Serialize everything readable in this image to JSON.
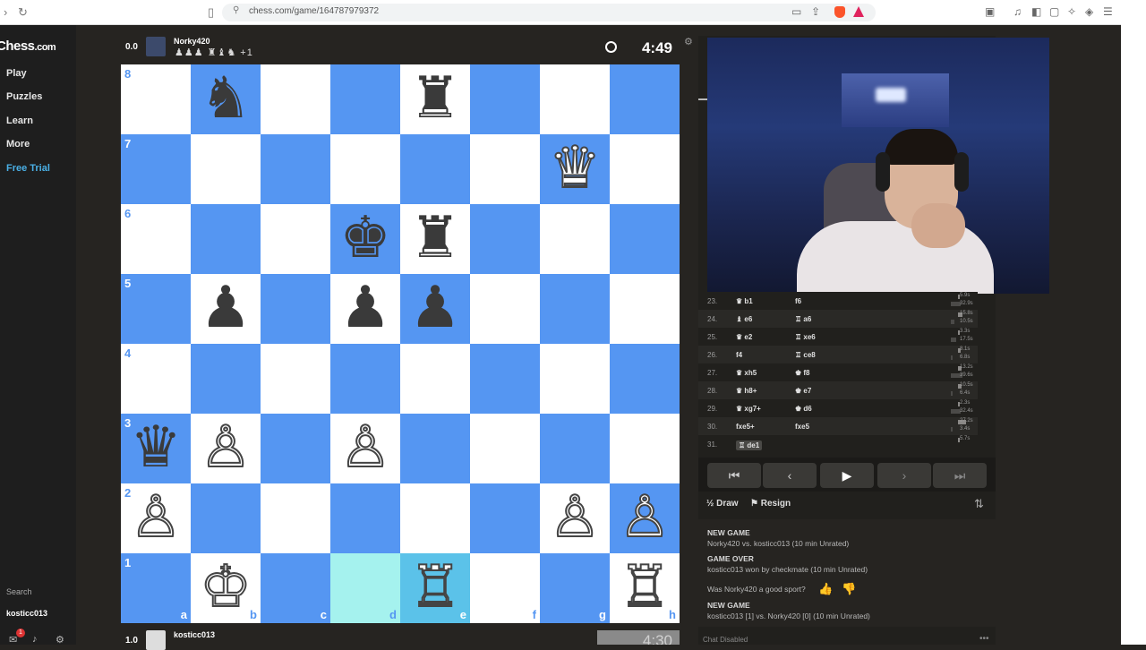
{
  "browser": {
    "url": "chess.com/game/164787979372"
  },
  "sidebar": {
    "logo": "Chess",
    "logo_suffix": ".com",
    "items": [
      {
        "label": "Play"
      },
      {
        "label": "Puzzles"
      },
      {
        "label": "Learn"
      },
      {
        "label": "More"
      },
      {
        "label": "Free Trial"
      }
    ],
    "search_label": "Search",
    "username": "kosticc013",
    "notification_count": "1"
  },
  "top_player": {
    "score": "0.0",
    "name": "Norky420",
    "captured": "♟♟♟ ♜♝♞ +1",
    "clock": "4:49"
  },
  "bottom_player": {
    "score": "1.0",
    "name": "kosticc013",
    "clock": "4:30"
  },
  "board": {
    "ranks": [
      "8",
      "7",
      "6",
      "5",
      "4",
      "3",
      "2",
      "1"
    ],
    "files": [
      "a",
      "b",
      "c",
      "d",
      "e",
      "f",
      "g",
      "h"
    ],
    "pieces": {
      "b8": "♞b",
      "e8": "♜b",
      "g7": "♛w",
      "d6": "♚b",
      "e6": "♜b",
      "b5": "♟b",
      "d5": "♟b",
      "e5": "♟b",
      "a3": "♛b",
      "b3": "♙w",
      "d3": "♙w",
      "a2": "♙w",
      "g2": "♙w",
      "h2": "♙w",
      "b1": "♔w",
      "e1": "♖w",
      "h1": "♖w"
    },
    "highlight": [
      "d1",
      "e1"
    ],
    "colors": {
      "light": "#ffffff",
      "dark": "#5596f2",
      "from": "#a5f2ee",
      "to": "#5bc2e9"
    }
  },
  "moves": [
    {
      "n": "23.",
      "w": "♛ b1",
      "b": "f6",
      "tw": "5.9s",
      "tb": "32.9s"
    },
    {
      "n": "24.",
      "w": "♝ e6",
      "b": "♖ a6",
      "tw": "15.8s",
      "tb": "10.5s"
    },
    {
      "n": "25.",
      "w": "♛ e2",
      "b": "♖ xe6",
      "tw": "3.3s",
      "tb": "17.5s"
    },
    {
      "n": "26.",
      "w": "f4",
      "b": "♖ ce8",
      "tw": "8.1s",
      "tb": "6.8s"
    },
    {
      "n": "27.",
      "w": "♛ xh5",
      "b": "♚ f8",
      "tw": "13.2s",
      "tb": "39.6s"
    },
    {
      "n": "28.",
      "w": "♛ h8+",
      "b": "♚ e7",
      "tw": "10.5s",
      "tb": "6.4s"
    },
    {
      "n": "29.",
      "w": "♛ xg7+",
      "b": "♚ d6",
      "tw": "2.3s",
      "tb": "32.4s"
    },
    {
      "n": "30.",
      "w": "fxe5+",
      "b": "fxe5",
      "tw": "27.2s",
      "tb": "3.4s"
    },
    {
      "n": "31.",
      "w": "♖ de1",
      "b": "",
      "tw": "5.7s",
      "tb": ""
    }
  ],
  "controls": {
    "first": "⏮",
    "prev": "‹",
    "play": "▶",
    "next": "›",
    "last": "⏭"
  },
  "actions": {
    "draw": "Draw",
    "resign": "Resign"
  },
  "chat": {
    "new_game_1": "NEW GAME",
    "new_game_1_text": "Norky420 vs. kosticc013 (10 min Unrated)",
    "game_over": "GAME OVER",
    "game_over_text": "kosticc013 won by checkmate (10 min Unrated)",
    "sport_question": "Was Norky420 a good sport?",
    "new_game_2": "NEW GAME",
    "new_game_2_text": "kosticc013 [1] vs. Norky420 [0] (10 min Unrated)",
    "disabled": "Chat Disabled"
  }
}
